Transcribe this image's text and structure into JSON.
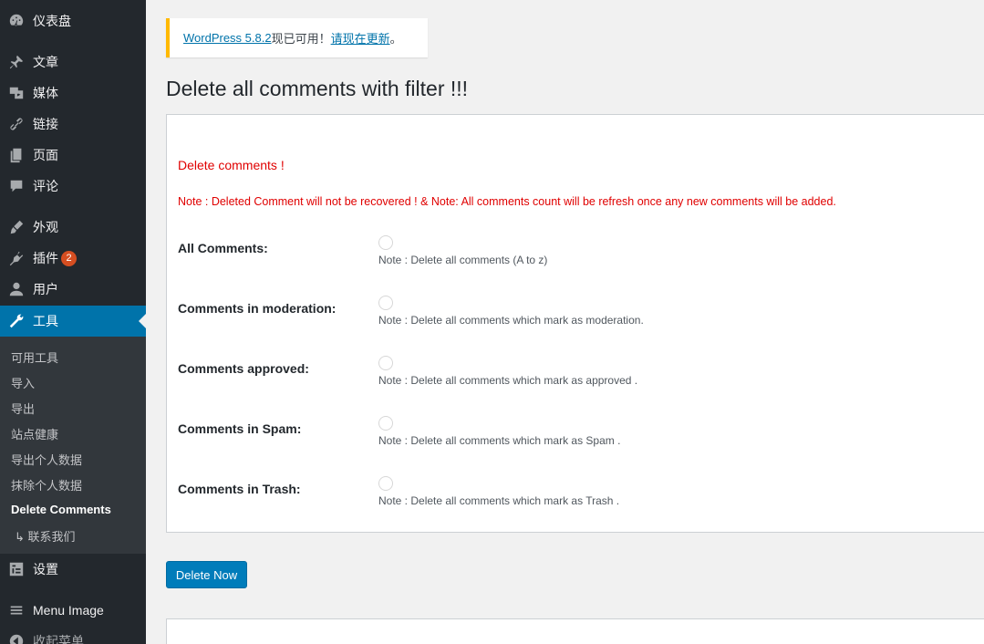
{
  "sidebar": {
    "items": [
      {
        "label": "仪表盘",
        "icon": "dashboard-icon"
      },
      {
        "label": "文章",
        "icon": "pin-icon"
      },
      {
        "label": "媒体",
        "icon": "media-icon"
      },
      {
        "label": "链接",
        "icon": "link-icon"
      },
      {
        "label": "页面",
        "icon": "page-icon"
      },
      {
        "label": "评论",
        "icon": "comment-icon"
      },
      {
        "label": "外观",
        "icon": "brush-icon"
      },
      {
        "label": "插件",
        "icon": "plugin-icon",
        "badge": "2"
      },
      {
        "label": "用户",
        "icon": "user-icon"
      },
      {
        "label": "工具",
        "icon": "wrench-icon"
      },
      {
        "label": "设置",
        "icon": "settings-icon"
      },
      {
        "label": "Menu Image",
        "icon": "menu-icon"
      },
      {
        "label": "收起菜单",
        "icon": "collapse-icon"
      }
    ],
    "submenu": [
      "可用工具",
      "导入",
      "导出",
      "站点健康",
      "导出个人数据",
      "抹除个人数据",
      "Delete Comments",
      "↳ 联系我们"
    ]
  },
  "notice": {
    "link_version": "WordPress 5.8.2",
    "text": "现已可用！",
    "link_update": "请现在更新",
    "suffix": "。"
  },
  "page": {
    "title": "Delete all comments with filter !!!",
    "heading": "Delete comments !",
    "note": "Note : Deleted Comment will not be recovered ! & Note: All comments count will be refresh once any new comments will be added."
  },
  "options": [
    {
      "label": "All Comments:",
      "note": "Note : Delete all comments (A to z)"
    },
    {
      "label": "Comments in moderation:",
      "note": "Note : Delete all comments which mark as moderation."
    },
    {
      "label": "Comments approved:",
      "note": "Note : Delete all comments which mark as approved ."
    },
    {
      "label": "Comments in Spam:",
      "note": "Note : Delete all comments which mark as Spam ."
    },
    {
      "label": "Comments in Trash:",
      "note": "Note : Delete all comments which mark as Trash ."
    }
  ],
  "button": {
    "label": "Delete Now"
  },
  "colors": {
    "sidebar": "#23282d",
    "active": "#0073aa",
    "accent_red": "#e00000",
    "notice_border": "#ffb900",
    "button": "#007cba"
  }
}
